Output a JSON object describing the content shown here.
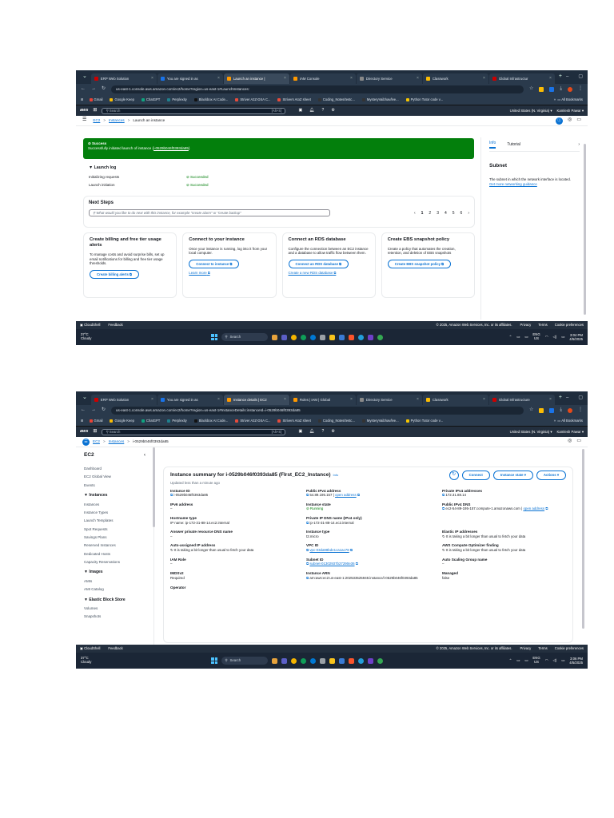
{
  "shot1": {
    "tabs": [
      {
        "label": "ERP Web Solution",
        "color": "#c00"
      },
      {
        "label": "You are signed in as",
        "color": "#1a73e8"
      },
      {
        "label": "Launch an instance |",
        "color": "#ff9900",
        "active": true
      },
      {
        "label": "IAM Console",
        "color": "#ff9900"
      },
      {
        "label": "Directory Service",
        "color": "#888"
      },
      {
        "label": "Classwork",
        "color": "#fbbc04"
      },
      {
        "label": "Global Infrastructur",
        "color": "#c00"
      }
    ],
    "url": "us-east-1.console.aws.amazon.com/ec2/home?region=us-east-1#LaunchInstances:",
    "bookmarks": [
      "Gmail",
      "Google Keep",
      "ChatGPT",
      "Perplexity",
      "Blackbox AI Code...",
      "Striver A2Z-DSA C...",
      "Strivers AtoZ sheet",
      "Coding_Notes/testc...",
      "MysteryVaibhav/lee...",
      "Python Tutor code v..."
    ],
    "all_bookmarks": "All Bookmarks",
    "aws": {
      "logo": "aws",
      "search_placeholder": "Search",
      "shortcut": "[Alt+S]",
      "region": "United States (N. Virginia) ▾",
      "user": "Kamlesh Pawar ▾"
    },
    "breadcrumb": {
      "ec2": "EC2",
      "instances": "Instances",
      "current": "Launch an instance"
    },
    "flash": {
      "title": "Success",
      "message": "Successfully initiated launch of instance (",
      "instance_link": "i-0529b046f0393da85",
      "message_end": ")"
    },
    "launch_log": {
      "title": "Launch log",
      "rows": [
        {
          "label": "Initializing requests",
          "status": "Succeeded"
        },
        {
          "label": "Launch initiation",
          "status": "Succeeded"
        }
      ]
    },
    "next_steps": {
      "title": "Next Steps",
      "placeholder": "What would you like to do next with this instance, for example \"create alarm\" or \"create backup\"",
      "pages": [
        "1",
        "2",
        "3",
        "4",
        "5",
        "6"
      ]
    },
    "cards": [
      {
        "title": "Create billing and free tier usage alerts",
        "text": "To manage costs and avoid surprise bills, set up email notifications for billing and free tier usage thresholds.",
        "button": "Create billing alerts",
        "link": ""
      },
      {
        "title": "Connect to your instance",
        "text": "Once your instance is running, log into it from your local computer.",
        "button": "Connect to instance",
        "link": "Learn more"
      },
      {
        "title": "Connect an RDS database",
        "text": "Configure the connection between an EC2 instance and a database to allow traffic flow between them.",
        "button": "Connect an RDS database",
        "link": "Create a new RDS database"
      },
      {
        "title": "Create EBS snapshot policy",
        "text": "Create a policy that automates the creation, retention, and deletion of EBS snapshots",
        "button": "Create EBS snapshot policy",
        "link": ""
      }
    ],
    "info_panel": {
      "tab_info": "Info",
      "tab_tutorial": "Tutorial",
      "heading": "Subnet",
      "text": "The subnet in which the network interface is located.",
      "link": "Get more networking guidance"
    },
    "footer": {
      "cloudshell": "CloudShell",
      "feedback": "Feedback",
      "copyright": "© 2025, Amazon Web Services, Inc. or its affiliates.",
      "privacy": "Privacy",
      "terms": "Terms",
      "cookies": "Cookie preferences"
    },
    "taskbar": {
      "temp": "37°C",
      "weather": "Cloudy",
      "search": "Search",
      "lang": "ENG",
      "region": "US",
      "time": "3:04 PM",
      "date": "4/5/2025"
    }
  },
  "shot2": {
    "tabs": [
      {
        "label": "ERP Web Solution",
        "color": "#c00"
      },
      {
        "label": "You are signed in as",
        "color": "#1a73e8"
      },
      {
        "label": "Instance details | EC2",
        "color": "#ff9900",
        "active": true
      },
      {
        "label": "Roles | IAM | Global",
        "color": "#ff9900"
      },
      {
        "label": "Directory Service",
        "color": "#888"
      },
      {
        "label": "Classwork",
        "color": "#fbbc04"
      },
      {
        "label": "Global Infrastructure",
        "color": "#c00"
      }
    ],
    "url": "us-east-1.console.aws.amazon.com/ec2/home?region=us-east-1#InstanceDetails:instanceId=i-0529b046f0393da85",
    "bookmarks": [
      "Gmail",
      "Google Keep",
      "ChatGPT",
      "Perplexity",
      "Blackbox AI Code...",
      "Striver A2Z-DSA C...",
      "Strivers AtoZ sheet",
      "Coding_Notes/testc...",
      "MysteryVaibhav/lee...",
      "Python Tutor code v..."
    ],
    "all_bookmarks": "All Bookmarks",
    "aws": {
      "logo": "aws",
      "search_placeholder": "Search",
      "shortcut": "[Alt+S]",
      "region": "United States (N. Virginia) ▾",
      "user": "Kamlesh Pawar ▾"
    },
    "breadcrumb": {
      "ec2": "EC2",
      "instances": "Instances",
      "current": "i-0529b046f0393da85"
    },
    "sidenav": {
      "title": "EC2",
      "top_items": [
        "Dashboard",
        "EC2 Global View",
        "Events"
      ],
      "sections": [
        {
          "title": "Instances",
          "items": [
            "Instances",
            "Instance Types",
            "Launch Templates",
            "Spot Requests",
            "Savings Plans",
            "Reserved Instances",
            "Dedicated Hosts",
            "Capacity Reservations"
          ]
        },
        {
          "title": "Images",
          "items": [
            "AMIs",
            "AMI Catalog"
          ]
        },
        {
          "title": "Elastic Block Store",
          "items": [
            "Volumes",
            "Snapshots"
          ]
        }
      ]
    },
    "summary": {
      "title": "Instance summary for i-0529b046f0393da85 (FIrst_EC2_Instance)",
      "info": "Info",
      "subtitle": "Updated less than a minute ago",
      "connect": "Connect",
      "instance_state_btn": "Instance state ▾",
      "actions_btn": "Actions ▾",
      "fields": [
        {
          "label": "Instance ID",
          "value": "i-0529b046f0393da85",
          "copy": true
        },
        {
          "label": "Public IPv4 address",
          "value": "54.89.195.157",
          "copy": true,
          "link": "open address"
        },
        {
          "label": "Private IPv4 addresses",
          "value": "172.31.88.14",
          "copy": true
        },
        {
          "label": "IPv6 address",
          "value": "–"
        },
        {
          "label": "Instance state",
          "value": "Running",
          "status": "running"
        },
        {
          "label": "Public IPv4 DNS",
          "value": "ec2-54-89-195-157.compute-1.amazonaws.com",
          "copy": true,
          "link": "open address"
        },
        {
          "label": "Hostname type",
          "value": "IP name: ip-172-31-88-14.ec2.internal"
        },
        {
          "label": "Private IP DNS name (IPv4 only)",
          "value": "ip-172-31-88-14.ec2.internal",
          "copy": true
        },
        {
          "label": "",
          "value": ""
        },
        {
          "label": "Answer private resource DNS name",
          "value": "–"
        },
        {
          "label": "Instance type",
          "value": "t2.micro"
        },
        {
          "label": "Elastic IP addresses",
          "value": "It is taking a bit longer than usual to fetch your data"
        },
        {
          "label": "Auto-assigned IP address",
          "value": "It is taking a bit longer than usual to fetch your data"
        },
        {
          "label": "VPC ID",
          "value": "vpc-03da98bde1ca1ac78",
          "copy": true,
          "islink": true
        },
        {
          "label": "AWS Compute Optimizer finding",
          "value": "It is taking a bit longer than usual to fetch your data"
        },
        {
          "label": "IAM Role",
          "value": "–"
        },
        {
          "label": "Subnet ID",
          "value": "subnet-01302937b27290e36",
          "copy": true,
          "islink": true
        },
        {
          "label": "Auto Scaling Group name",
          "value": "–"
        },
        {
          "label": "IMDSv2",
          "value": "Required"
        },
        {
          "label": "Instance ARN",
          "value": "arn:aws:ec2:us-east-1:202533525945:instance/i-0529b046f0393da85",
          "copy": true
        },
        {
          "label": "Managed",
          "value": "false"
        }
      ],
      "operator": "Operator"
    },
    "footer": {
      "cloudshell": "CloudShell",
      "feedback": "Feedback",
      "copyright": "© 2025, Amazon Web Services, Inc. or its affiliates.",
      "privacy": "Privacy",
      "terms": "Terms",
      "cookies": "Cookie preferences"
    },
    "taskbar": {
      "temp": "37°C",
      "weather": "Cloudy",
      "search": "Search",
      "lang": "ENG",
      "region": "US",
      "time": "3:06 PM",
      "date": "4/5/2025"
    }
  },
  "colors": {
    "aws_nav": "#232f3e",
    "link": "#0972d3",
    "success": "#037f0c",
    "chrome_tabs": "#1f2d3d"
  }
}
